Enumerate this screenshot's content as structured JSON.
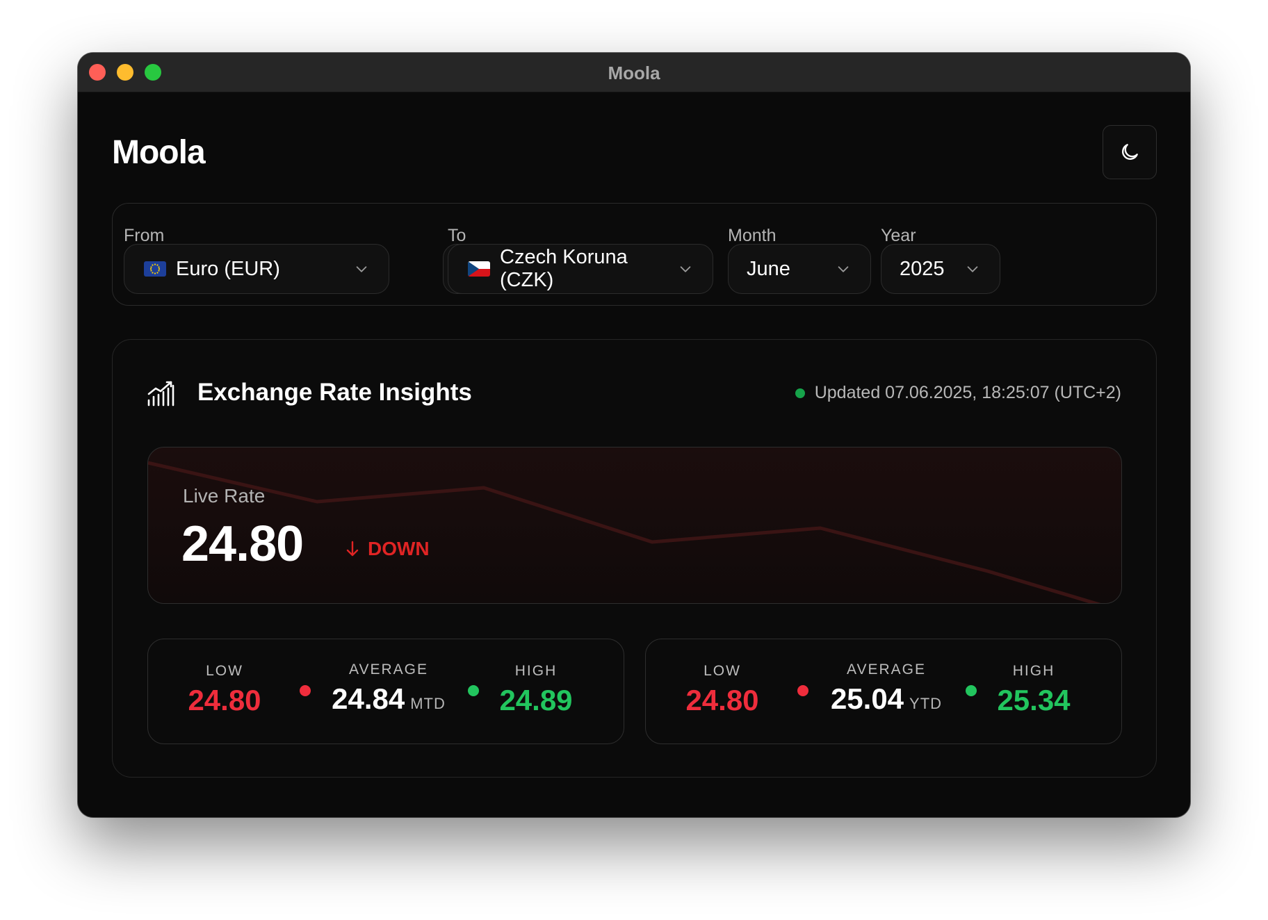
{
  "window": {
    "title": "Moola"
  },
  "app": {
    "title": "Moola"
  },
  "controls": {
    "from": {
      "label": "From",
      "value": "Euro (EUR)",
      "flag": "eu-flag"
    },
    "to": {
      "label": "To",
      "value": "Czech Koruna (CZK)",
      "flag": "cz-flag"
    },
    "month": {
      "label": "Month",
      "value": "June"
    },
    "year": {
      "label": "Year",
      "value": "2025"
    }
  },
  "insights": {
    "title": "Exchange Rate Insights",
    "updated": "Updated 07.06.2025, 18:25:07 (UTC+2)",
    "live": {
      "label": "Live Rate",
      "value": "24.80",
      "trend": "DOWN"
    },
    "mtd": {
      "low_label": "LOW",
      "low": "24.80",
      "avg_label": "AVERAGE",
      "avg": "24.84",
      "suffix": "MTD",
      "high_label": "HIGH",
      "high": "24.89"
    },
    "ytd": {
      "low_label": "LOW",
      "low": "24.80",
      "avg_label": "AVERAGE",
      "avg": "25.04",
      "suffix": "YTD",
      "high_label": "HIGH",
      "high": "25.34"
    }
  },
  "colors": {
    "background": "#0a0a0a",
    "down": "#e02424",
    "low": "#ef2d3c",
    "high": "#22c55e",
    "status_dot": "#16a34a"
  },
  "icons": {
    "theme": "moon-icon",
    "swap": "swap-arrows-icon",
    "insights": "chart-bars-trend-icon",
    "trend": "arrow-down-icon",
    "dropdown": "chevron-down-icon"
  }
}
